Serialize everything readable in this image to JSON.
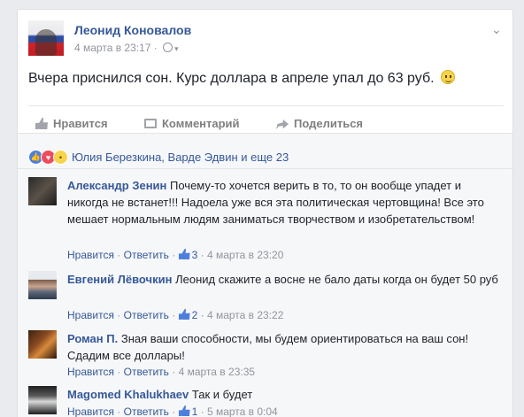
{
  "post": {
    "author": "Леонид Коновалов",
    "date": "4 марта в 23:17",
    "dot": "·",
    "text": "Вчера приснился сон. Курс доллара в апреле упал до 63 руб.",
    "actions": {
      "like": "Нравится",
      "comment": "Комментарий",
      "share": "Поделиться"
    },
    "reactions_text": "Юлия Березкина, Варде Эдвин и еще 23",
    "icons": {
      "privacy": "globe-icon",
      "menu": "chevron-down-icon",
      "emoji": "smiley-icon"
    }
  },
  "comments": [
    {
      "name": "Александр Зенин",
      "text": "Почему-то хочется верить в то, то он вообще упадет и никогда не встанет!!! Надоела уже вся эта политическая чертовщина! Все это мешает нормальным людям заниматься творчеством и изобретательством!",
      "like": "Нравится",
      "reply": "Ответить",
      "likes": "3",
      "time": "4 марта в 23:20"
    },
    {
      "name": "Евгений Лёвочкин",
      "text": "Леонид скажите а восне не бало даты когда он будет 50 руб",
      "like": "Нравится",
      "reply": "Ответить",
      "likes": "2",
      "time": "4 марта в 23:22"
    },
    {
      "name": "Роман П.",
      "text": "Зная ваши способности, мы будем ориентироваться на ваш сон! Сдадим все доллары!",
      "like": "Нравится",
      "reply": "Ответить",
      "time": "4 марта в 23:35"
    },
    {
      "name": "Magomed Khalukhaev",
      "text": "Так и будет",
      "like": "Нравится",
      "reply": "Ответить",
      "likes": "1",
      "time": "5 марта в 0:04"
    }
  ],
  "sep": " · "
}
